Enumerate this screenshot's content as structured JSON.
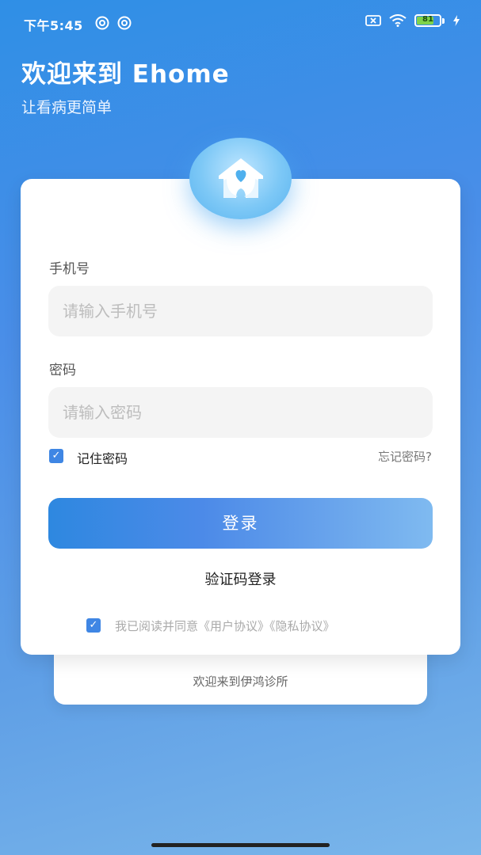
{
  "status_bar": {
    "time": "下午5:45",
    "battery_level": "81",
    "icons": [
      "eye-icon",
      "eye-icon",
      "sim-off-icon",
      "wifi-icon",
      "battery-icon",
      "charging-icon"
    ]
  },
  "header": {
    "title": "欢迎来到 Ehome",
    "subtitle": "让看病更简单"
  },
  "logo": {
    "icon": "house-heart-icon"
  },
  "form": {
    "phone_label": "手机号",
    "phone_placeholder": "请输入手机号",
    "password_label": "密码",
    "password_placeholder": "请输入密码",
    "remember_label": "记住密码",
    "remember_checked": true,
    "forgot_label": "忘记密码?",
    "login_button": "登录",
    "sms_login": "验证码登录",
    "agreement_text": "我已阅读并同意《用户协议》《隐私协议》",
    "agreement_checked": true
  },
  "back_card": {
    "text": "欢迎来到伊鸿诊所"
  },
  "colors": {
    "accent": "#3f86e4",
    "gradient_start": "#2f8fe6",
    "gradient_end": "#7ab6ea",
    "battery_green": "#7fd34a"
  }
}
